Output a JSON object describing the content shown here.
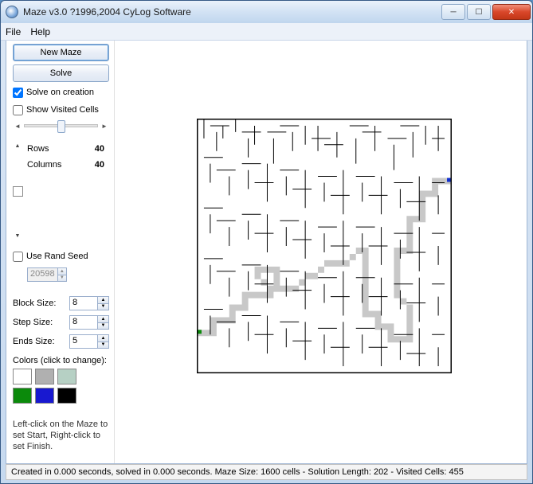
{
  "window": {
    "title": "Maze v3.0 ?1996,2004 CyLog Software"
  },
  "menu": {
    "file": "File",
    "help": "Help"
  },
  "sidebar": {
    "new_maze": "New Maze",
    "solve": "Solve",
    "solve_on_creation": "Solve on creation",
    "show_visited_cells": "Show Visited Cells",
    "rows_label": "Rows",
    "rows_value": "40",
    "cols_label": "Columns",
    "cols_value": "40",
    "use_rand_seed": "Use Rand Seed",
    "seed_value": "20598",
    "block_size_label": "Block Size:",
    "block_size_value": "8",
    "step_size_label": "Step Size:",
    "step_size_value": "8",
    "ends_size_label": "Ends Size:",
    "ends_size_value": "5",
    "colors_label": "Colors (click to change):",
    "hint": "Left-click on the Maze to set Start, Right-click to set Finish."
  },
  "colors": {
    "bg": "#ffffff",
    "wall": "#b0b0b0",
    "visited": "#b6d0c4",
    "start": "#0b8a0b",
    "finish": "#1818d0",
    "path": "#000000"
  },
  "status": {
    "text": "Created in 0.000 seconds, solved in 0.000 seconds. Maze Size: 1600 cells - Solution Length: 202 - Visited Cells: 455"
  }
}
